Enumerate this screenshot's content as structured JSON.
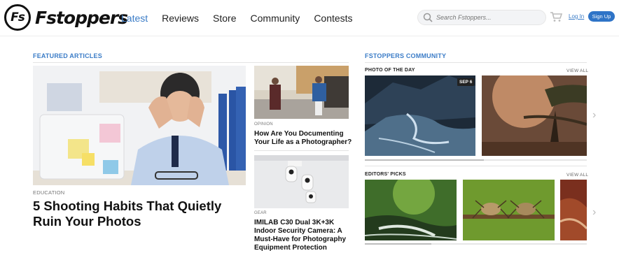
{
  "brand": {
    "mark": "Fs",
    "name": "Fstoppers"
  },
  "nav": [
    {
      "label": "Latest",
      "active": true
    },
    {
      "label": "Reviews",
      "active": false
    },
    {
      "label": "Store",
      "active": false
    },
    {
      "label": "Community",
      "active": false
    },
    {
      "label": "Contests",
      "active": false
    }
  ],
  "search": {
    "placeholder": "Search Fstoppers..."
  },
  "auth": {
    "login": "Log In",
    "signup": "Sign Up"
  },
  "featured": {
    "title": "FEATURED ARTICLES",
    "main": {
      "category": "EDUCATION",
      "headline": "5 Shooting Habits That Quietly Ruin Your Photos"
    },
    "side": [
      {
        "category": "OPINION",
        "headline": "How Are You Documenting Your Life as a Photographer?"
      },
      {
        "category": "GEAR",
        "headline": "IMILAB C30 Dual 3K+3K Indoor Security Camera: A Must-Have for Photography Equipment Protection"
      }
    ]
  },
  "community": {
    "title": "FSTOPPERS COMMUNITY",
    "photo_of_day": {
      "label": "PHOTO OF THE DAY",
      "view_all": "VIEW ALL",
      "badge": "SEP 6"
    },
    "editors_picks": {
      "label": "EDITORS' PICKS",
      "view_all": "VIEW ALL"
    }
  },
  "colors": {
    "accent": "#3b7cc7",
    "signup": "#2f74c7"
  }
}
